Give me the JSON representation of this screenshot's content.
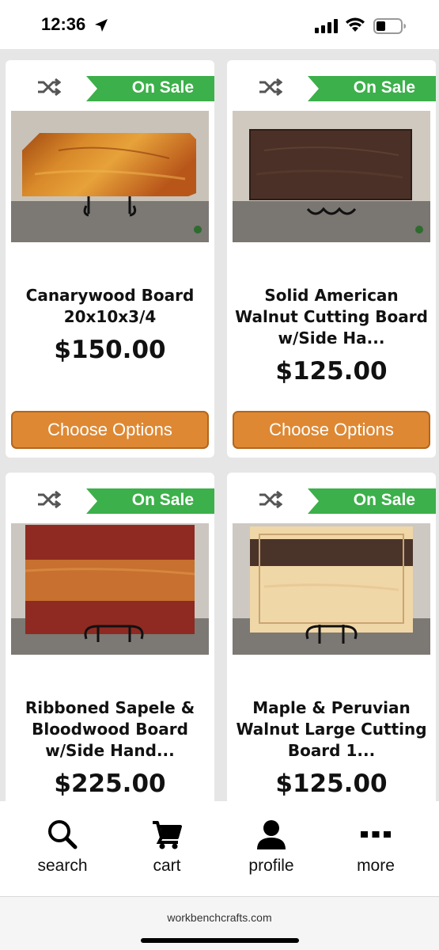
{
  "status_bar": {
    "time": "12:36",
    "icons": [
      "location-arrow-icon",
      "cellular-signal-icon",
      "wifi-icon",
      "battery-icon"
    ]
  },
  "products": [
    {
      "name": "Canarywood Board 20x10x3/4",
      "price": "$150.00",
      "badge": "On Sale",
      "button": "Choose Options"
    },
    {
      "name": "Solid American Walnut Cutting Board w/Side Ha...",
      "price": "$125.00",
      "badge": "On Sale",
      "button": "Choose Options"
    },
    {
      "name": "Ribboned Sapele & Bloodwood Board w/Side Hand...",
      "price": "$225.00",
      "badge": "On Sale"
    },
    {
      "name": "Maple & Peruvian Walnut Large Cutting Board 1...",
      "price": "$125.00",
      "badge": "On Sale"
    }
  ],
  "bottom_nav": [
    {
      "label": "search",
      "icon": "search-icon"
    },
    {
      "label": "cart",
      "icon": "cart-icon"
    },
    {
      "label": "profile",
      "icon": "profile-icon"
    },
    {
      "label": "more",
      "icon": "more-icon"
    }
  ],
  "browser": {
    "url": "workbenchcrafts.com"
  },
  "colors": {
    "sale_badge": "#3cb04a",
    "choose_button": "#de8833",
    "background": "#e6e6e6"
  }
}
